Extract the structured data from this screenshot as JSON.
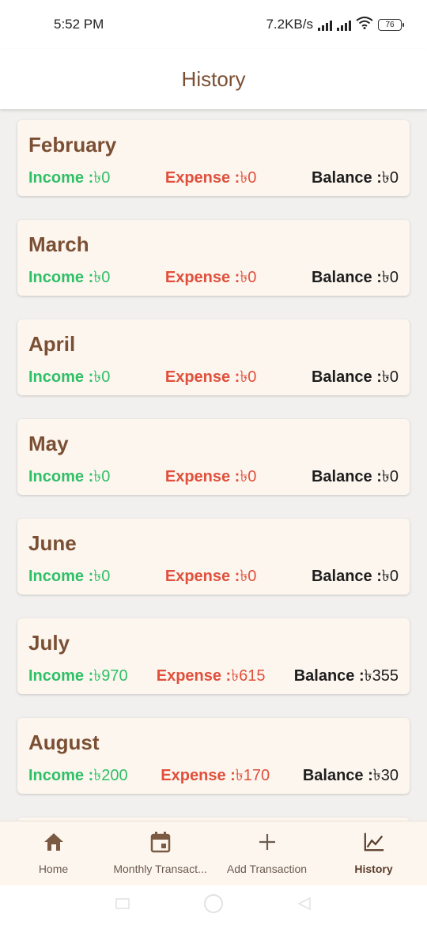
{
  "status_bar": {
    "time": "5:52 PM",
    "network_speed": "7.2KB/s",
    "battery": "76",
    "icons": [
      "signal-icon",
      "signal-icon",
      "wifi-icon",
      "battery-icon"
    ]
  },
  "app_bar": {
    "title": "History"
  },
  "colors": {
    "accent": "#7b4f33",
    "income": "#2fbf67",
    "expense": "#e0503c",
    "balance": "#1d1d1d",
    "card_background": "#fdf6ef"
  },
  "months": [
    {
      "name": "February",
      "income_label": "Income :",
      "income": "৳0",
      "expense_label": "Expense :",
      "expense": "৳0",
      "balance_label": "Balance :",
      "balance": "৳0"
    },
    {
      "name": "March",
      "income_label": "Income :",
      "income": "৳0",
      "expense_label": "Expense :",
      "expense": "৳0",
      "balance_label": "Balance :",
      "balance": "৳0"
    },
    {
      "name": "April",
      "income_label": "Income :",
      "income": "৳0",
      "expense_label": "Expense :",
      "expense": "৳0",
      "balance_label": "Balance :",
      "balance": "৳0"
    },
    {
      "name": "May",
      "income_label": "Income :",
      "income": "৳0",
      "expense_label": "Expense :",
      "expense": "৳0",
      "balance_label": "Balance :",
      "balance": "৳0"
    },
    {
      "name": "June",
      "income_label": "Income :",
      "income": "৳0",
      "expense_label": "Expense :",
      "expense": "৳0",
      "balance_label": "Balance :",
      "balance": "৳0"
    },
    {
      "name": "July",
      "income_label": "Income :",
      "income": "৳970",
      "expense_label": "Expense :",
      "expense": "৳615",
      "balance_label": "Balance :",
      "balance": "৳355"
    },
    {
      "name": "August",
      "income_label": "Income :",
      "income": "৳200",
      "expense_label": "Expense :",
      "expense": "৳170",
      "balance_label": "Balance :",
      "balance": "৳30"
    }
  ],
  "bottom_nav": {
    "items": [
      {
        "label": "Home",
        "icon": "home-icon",
        "active": false
      },
      {
        "label": "Monthly Transact...",
        "icon": "calendar-icon",
        "active": false
      },
      {
        "label": "Add Transaction",
        "icon": "plus-icon",
        "active": false
      },
      {
        "label": "History",
        "icon": "chart-line-icon",
        "active": true
      }
    ]
  }
}
